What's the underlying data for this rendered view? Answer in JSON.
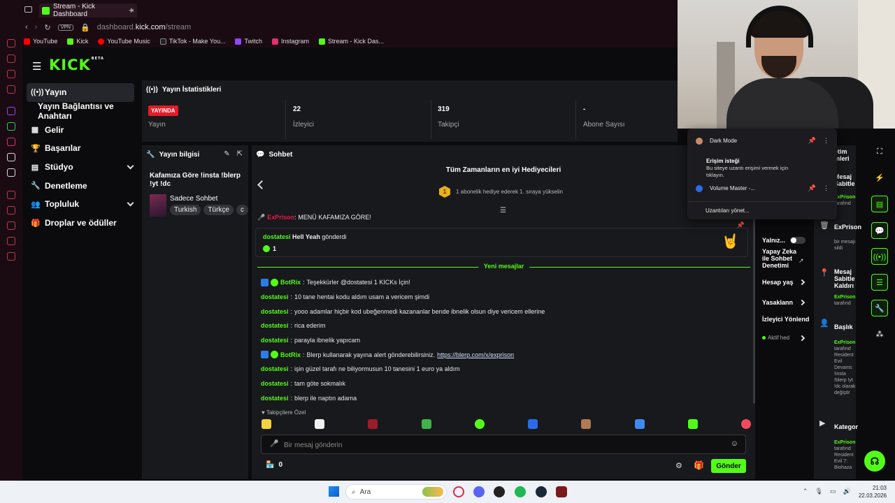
{
  "browser": {
    "tab_title": "Stream - Kick Dashboard",
    "new_tab": "+",
    "vpn": "VPN",
    "url_host": "dashboard.",
    "url_domain": "kick.com",
    "url_path": "/stream",
    "bookmarks": [
      "YouTube",
      "Kick",
      "YouTube Music",
      "TikTok - Make You...",
      "Twitch",
      "Instagram",
      "Stream - Kick Das..."
    ]
  },
  "brand": {
    "logo": "KICK",
    "logo_sup": "BETA"
  },
  "sidenav": {
    "items": [
      {
        "label": "Yayın"
      },
      {
        "label": "Yayın Bağlantısı ve Anahtarı"
      },
      {
        "label": "Gelir"
      },
      {
        "label": "Başarılar"
      },
      {
        "label": "Stüdyo"
      },
      {
        "label": "Denetleme"
      },
      {
        "label": "Topluluk"
      },
      {
        "label": "Droplar ve ödüller"
      }
    ]
  },
  "stats": {
    "title": "Yayın İstatistikleri",
    "live_badge": "YAYINDA",
    "live_label": "Yayın",
    "viewers_value": "22",
    "viewers_label": "İzleyici",
    "followers_value": "319",
    "followers_label": "Takipçi",
    "subs_value": "-",
    "subs_label": "Abone Sayısı"
  },
  "info": {
    "title": "Yayın bilgisi",
    "stream_title": "Kafamıza Göre !insta !blerp !yt !dc",
    "category": "Sadece Sohbet",
    "tags": [
      "Turkish",
      "Türkçe",
      "c"
    ]
  },
  "chat": {
    "title": "Sohbet",
    "gifters_title": "Tüm Zamanların en iyi Hediyecileri",
    "gifter_rank": "1",
    "gifter_text": "1 abonelik hediye ederek 1. sıraya yükselin",
    "pinned_user": "ExPrison",
    "pinned_text": "MENÜ KAFAMIZA GÖRE!",
    "gift_user": "dostatesi",
    "gift_item": "Hell Yeah",
    "gift_suffix": "gönderdi",
    "gift_count": "1",
    "new_messages": "Yeni mesajlar",
    "messages": [
      {
        "user": "BotRix",
        "text": "Teşekkürler @dostatesi 1 KICKs İçin!"
      },
      {
        "user": "dostatesi",
        "text": "10 tane hentai kodu aldım usam a vericem şimdi"
      },
      {
        "user": "dostatesi",
        "text": "yooo adamlar hiçbir kod ubeğenmedi kazananlar bende ibnelik olsun diye vericem ellerine"
      },
      {
        "user": "dostatesi",
        "text": "rica ederim"
      },
      {
        "user": "dostatesi",
        "text": "parayla ibnelik yapıcam"
      },
      {
        "user": "BotRix",
        "text": "Blerp kullanarak yayına alert gönderebilirsiniz.",
        "link": "https://blerp.com/x/exprison"
      },
      {
        "user": "dostatesi",
        "text": "işin güzel tarafı ne biliyormusun 10 tanesini 1 euro ya aldım"
      },
      {
        "user": "dostatesi",
        "text": "tam göte sokmalık"
      },
      {
        "user": "dostatesi",
        "text": "blerp ile naptın adama"
      }
    ],
    "followers_only": "Takipçilere Özel",
    "input_placeholder": "Bir mesaj gönderin",
    "kicks_count": "0",
    "send_label": "Gönder"
  },
  "moderation": {
    "item_yalniz": "Yalnız...",
    "item_ai": "Yapay Zeka ile Sohbet Denetimi",
    "item_account": "Hesap yaş",
    "item_bans": "Yasaklann",
    "item_viewer": "İzleyici Yönlend",
    "active": "Aktif hed"
  },
  "activity": {
    "title_top": "etim mleri",
    "items": [
      {
        "title": "Mesaj Sabitle",
        "user": "ExPrison",
        "sub": "tarafınd"
      },
      {
        "title": "ExPrison",
        "user": "",
        "sub": "bir mesajı sildi"
      },
      {
        "title": "Mesaj Sabitle Kaldırı",
        "user": "ExPrison",
        "sub": "tarafınd"
      },
      {
        "title": "Başlık",
        "user": "ExPrison",
        "sub": "tarafınd Resident Evil Devams !insta !blerp !yt !dc olarak değiştir"
      },
      {
        "title": "Kategor",
        "user": "ExPrison",
        "sub": "tarafınd Resident Evil 7: Biohaza"
      }
    ]
  },
  "extensions": {
    "dark_mode": "Dark Mode",
    "access_title": "Erişim isteği",
    "access_desc": "Bu siteye uzantı erişimi vermek için tıklayın.",
    "volume_master": "Volume Master -...",
    "manage": "Uzantıları yönet..."
  },
  "taskbar": {
    "search": "Ara",
    "time": "21:03",
    "date": "22.03.2026"
  },
  "colors": {
    "accent": "#53fc18",
    "live": "#e11d28",
    "bg": "#0b0b0d",
    "panel": "#18191c"
  }
}
